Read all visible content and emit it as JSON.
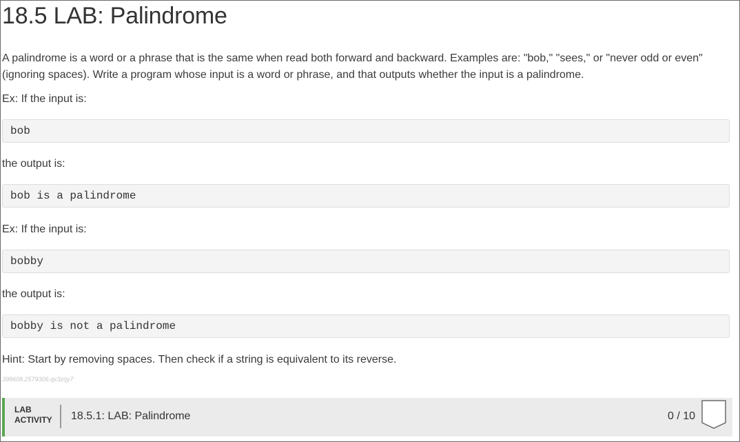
{
  "page": {
    "title": "18.5 LAB: Palindrome",
    "description": "A palindrome is a word or a phrase that is the same when read both forward and backward. Examples are: \"bob,\" \"sees,\" or \"never odd or even\" (ignoring spaces). Write a program whose input is a word or phrase, and that outputs whether the input is a palindrome.",
    "examples": [
      {
        "input_label": "Ex: If the input is:",
        "input": "bob",
        "output_label": "the output is:",
        "output": "bob is a palindrome"
      },
      {
        "input_label": "Ex: If the input is:",
        "input": "bobby",
        "output_label": "the output is:",
        "output": "bobby is not a palindrome"
      }
    ],
    "hint": "Hint: Start by removing spaces. Then check if a string is equivalent to its reverse.",
    "tracking_id": "398608.2579306.qx3zqy7"
  },
  "lab_activity": {
    "type_line1": "LAB",
    "type_line2": "ACTIVITY",
    "title": "18.5.1: LAB: Palindrome",
    "score": "0 / 10",
    "badge_icon": "shield-badge-icon",
    "accent_color": "#5aa552"
  }
}
